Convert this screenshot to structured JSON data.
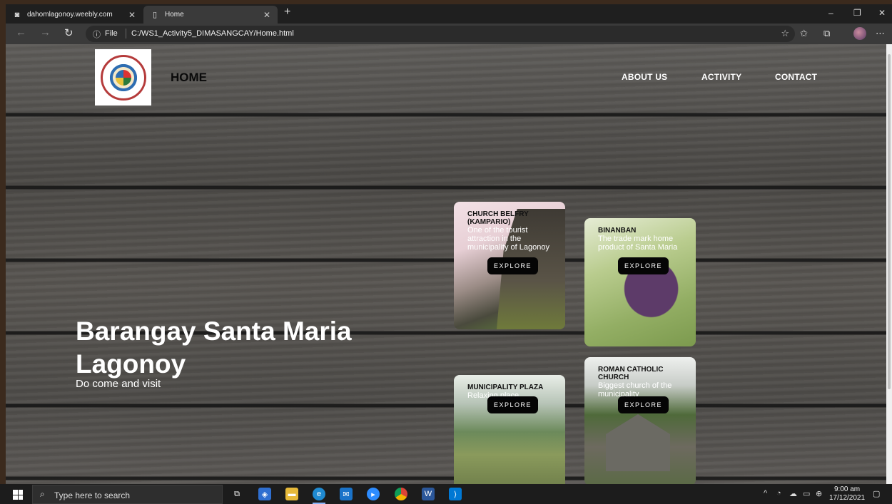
{
  "browser": {
    "tabs": [
      {
        "title": "dahomlagonoy.weebly.com",
        "icon": "weebly-icon"
      },
      {
        "title": "Home",
        "icon": "page-icon"
      }
    ],
    "address": {
      "scheme_label": "File",
      "url": "C:/WS1_Activity5_DIMASANGCAY/Home.html"
    }
  },
  "site": {
    "logo_alt": "BAYAN NG LAGONOY",
    "nav": {
      "home": "HOME",
      "about": "ABOUT US",
      "activity": "ACTIVITY",
      "contact": "CONTACT"
    },
    "hero": {
      "title": "Barangay Santa Maria Lagonoy",
      "subtitle": "Do come and visit"
    },
    "cards": [
      {
        "title": "CHURCH BELFRY (KAMPARIO)",
        "desc": "One of the tourist attraction in the municipality of Lagonoy",
        "button": "EXPLORE"
      },
      {
        "title": "BINANBAN",
        "desc": "The trade mark home product of Santa Maria",
        "button": "EXPLORE"
      },
      {
        "title": "MUNICIPALITY PLAZA",
        "desc": "Relaxing place",
        "button": "EXPLORE"
      },
      {
        "title": "ROMAN CATHOLIC CHURCH",
        "desc": "Biggest church of the municipality",
        "button": "EXPLORE"
      }
    ]
  },
  "taskbar": {
    "search_placeholder": "Type here to search",
    "time": "9:00 am",
    "date": "17/12/2021"
  },
  "colors": {
    "accent": "#8ab4f8",
    "button": "#050505",
    "wood": "#524f4b"
  }
}
